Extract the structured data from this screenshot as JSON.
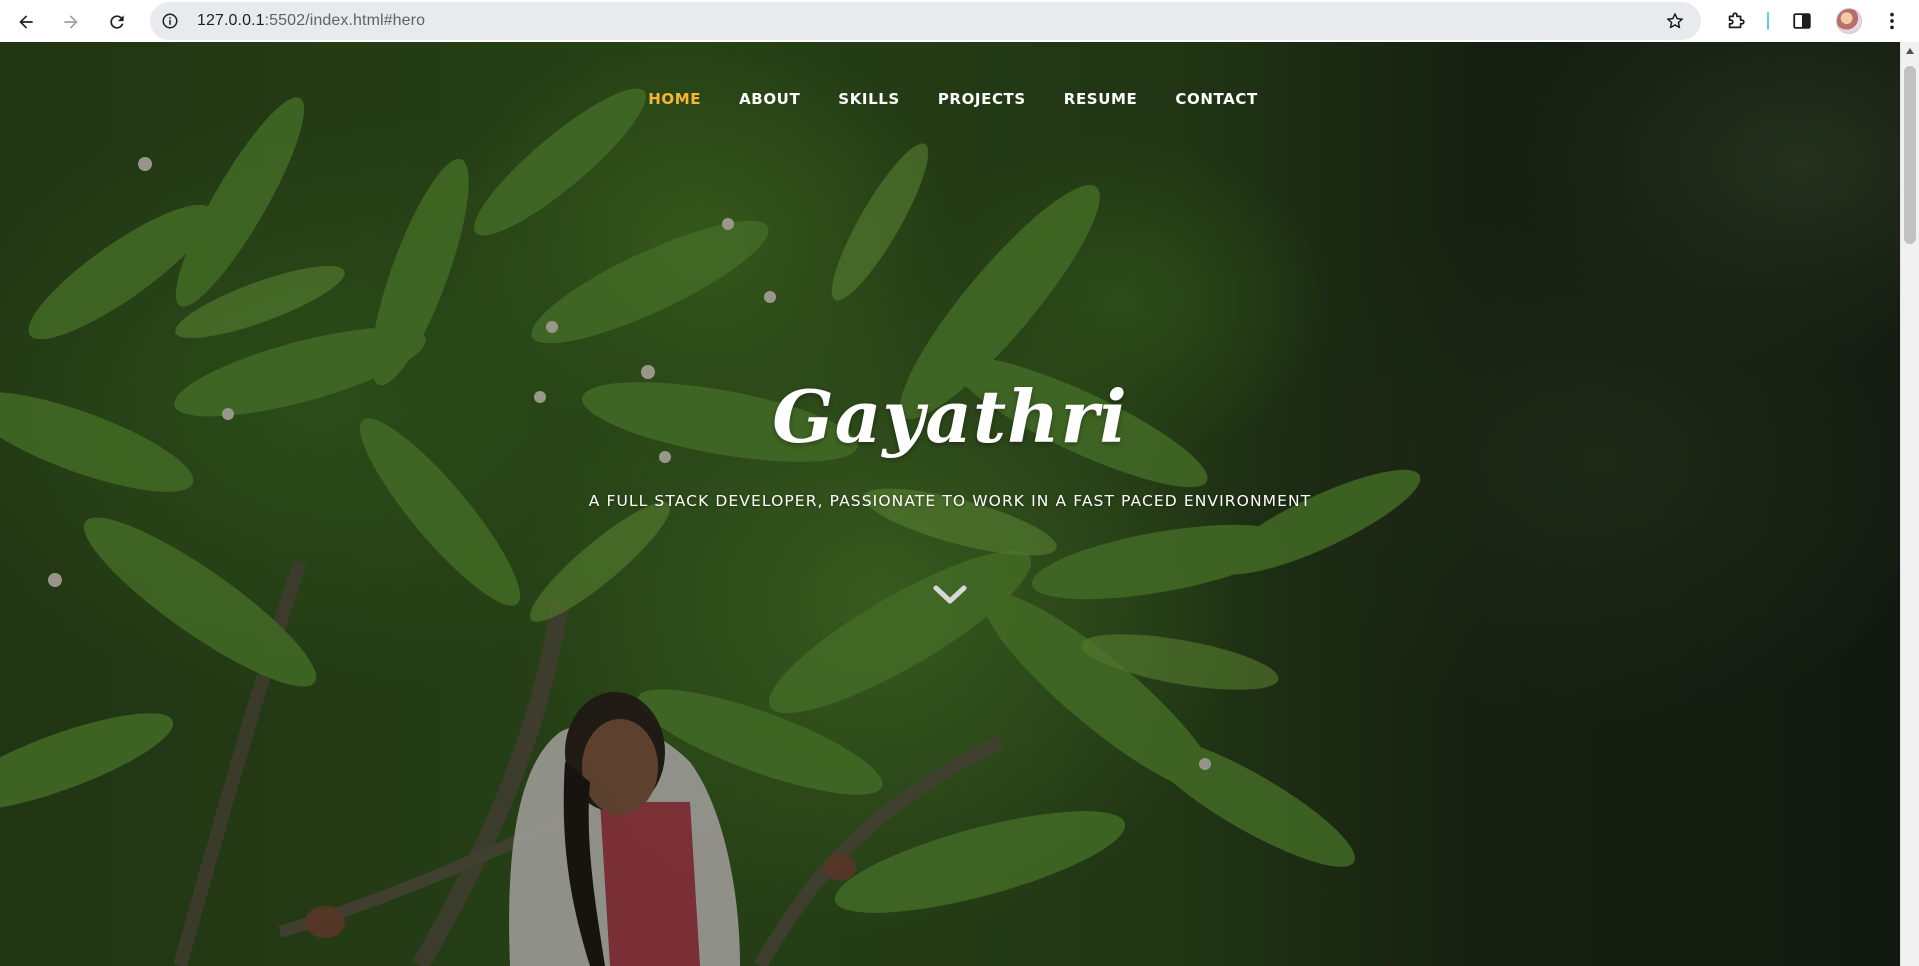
{
  "browser": {
    "url_host": "127.0.0.1",
    "url_path": ":5502/index.html#hero"
  },
  "nav": {
    "items": [
      {
        "label": "HOME",
        "active": true
      },
      {
        "label": "ABOUT",
        "active": false
      },
      {
        "label": "SKILLS",
        "active": false
      },
      {
        "label": "PROJECTS",
        "active": false
      },
      {
        "label": "RESUME",
        "active": false
      },
      {
        "label": "CONTACT",
        "active": false
      }
    ]
  },
  "hero": {
    "name": "Gayathri",
    "subtitle": "A FULL STACK DEVELOPER, PASSIONATE TO WORK IN A FAST PACED ENVIRONMENT"
  },
  "colors": {
    "accent": "#f7b733",
    "text": "#ffffff",
    "omnibox": "#e9eaed"
  },
  "icons": {
    "back": "arrow-left-icon",
    "forward": "arrow-right-icon",
    "reload": "reload-icon",
    "info": "info-icon",
    "bookmark": "star-icon",
    "extensions": "puzzle-icon",
    "side_panel": "side-panel-icon",
    "menu": "kebab-menu-icon",
    "scroll_down": "chevron-down-icon"
  }
}
